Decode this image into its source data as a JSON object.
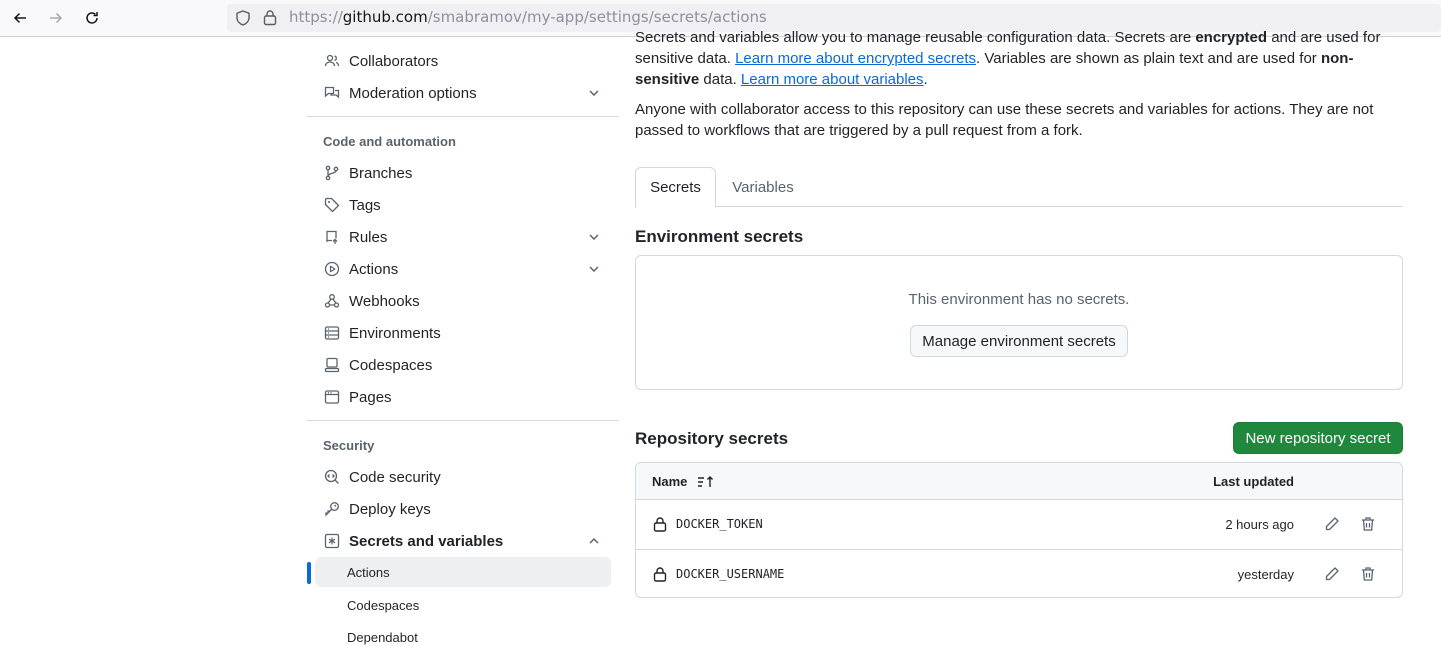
{
  "browser": {
    "url_prefix": "https://",
    "url_host": "github.com",
    "url_path": "/smabramov/my-app/settings/secrets/actions"
  },
  "sidebar": {
    "items_top": [
      {
        "label": "Collaborators",
        "icon": "people-icon"
      },
      {
        "label": "Moderation options",
        "icon": "comment-discussion-icon"
      }
    ],
    "code_heading": "Code and automation",
    "code_items": [
      {
        "label": "Branches",
        "icon": "git-branch-icon"
      },
      {
        "label": "Tags",
        "icon": "tag-icon"
      },
      {
        "label": "Rules",
        "icon": "repo-push-icon"
      },
      {
        "label": "Actions",
        "icon": "play-icon"
      },
      {
        "label": "Webhooks",
        "icon": "webhook-icon"
      },
      {
        "label": "Environments",
        "icon": "server-icon"
      },
      {
        "label": "Codespaces",
        "icon": "codespaces-icon"
      },
      {
        "label": "Pages",
        "icon": "browser-icon"
      }
    ],
    "security_heading": "Security",
    "security_items": [
      {
        "label": "Code security",
        "icon": "codescan-icon"
      },
      {
        "label": "Deploy keys",
        "icon": "key-icon"
      },
      {
        "label": "Secrets and variables",
        "icon": "asterisk-icon"
      }
    ],
    "sub_items": [
      "Actions",
      "Codespaces",
      "Dependabot"
    ]
  },
  "intro": {
    "p1_a": "Secrets and variables allow you to manage reusable configuration data. Secrets are ",
    "p1_b": "encrypted",
    "p1_c": " and are used for sensitive data. ",
    "p1_link1": "Learn more about encrypted secrets",
    "p1_d": ". Variables are shown as plain text and are used for ",
    "p1_e": "non-sensitive",
    "p1_f": " data. ",
    "p1_link2": "Learn more about variables",
    "p1_g": ".",
    "p2": "Anyone with collaborator access to this repository can use these secrets and variables for actions. They are not passed to workflows that are triggered by a pull request from a fork."
  },
  "tabs": [
    "Secrets",
    "Variables"
  ],
  "env": {
    "title": "Environment secrets",
    "empty_message": "This environment has no secrets.",
    "manage_button": "Manage environment secrets"
  },
  "repo": {
    "title": "Repository secrets",
    "new_button": "New repository secret",
    "col_name": "Name",
    "col_updated": "Last updated",
    "rows": [
      {
        "name": "DOCKER_TOKEN",
        "updated": "2 hours ago"
      },
      {
        "name": "DOCKER_USERNAME",
        "updated": "yesterday"
      }
    ]
  }
}
